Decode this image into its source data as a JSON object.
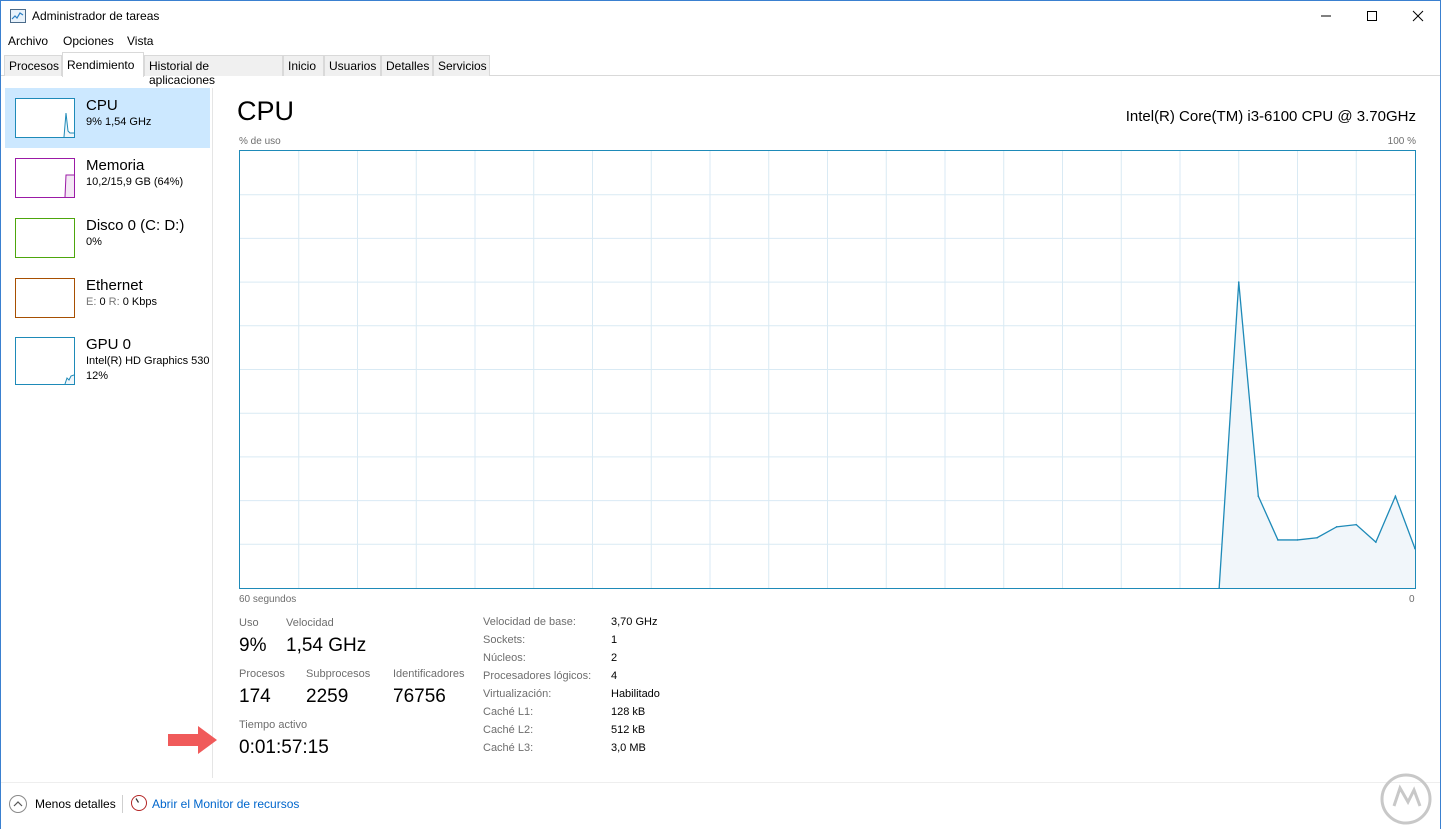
{
  "window": {
    "title": "Administrador de tareas",
    "minimize_glyph": "—",
    "maximize_glyph": "☐",
    "close_glyph": "✕",
    "border_color": "#3a80d0"
  },
  "menu": [
    "Archivo",
    "Opciones",
    "Vista"
  ],
  "tabs": [
    {
      "label": "Procesos",
      "active": false
    },
    {
      "label": "Rendimiento",
      "active": true
    },
    {
      "label": "Historial de aplicaciones",
      "active": false
    },
    {
      "label": "Inicio",
      "active": false
    },
    {
      "label": "Usuarios",
      "active": false
    },
    {
      "label": "Detalles",
      "active": false
    },
    {
      "label": "Servicios",
      "active": false
    }
  ],
  "sidebar": {
    "items": [
      {
        "title": "CPU",
        "sub": "9%  1,54 GHz",
        "color": "#1e8ab8",
        "selected": true
      },
      {
        "title": "Memoria",
        "sub": "10,2/15,9 GB (64%)",
        "color": "#9b1aa6",
        "selected": false
      },
      {
        "title": "Disco 0 (C: D:)",
        "sub": "0%",
        "color": "#4da60c",
        "selected": false
      },
      {
        "title": "Ethernet",
        "sub_prefix_e": "E:",
        "sub_e": "0",
        "sub_prefix_r": "R:",
        "sub_r": "0 Kbps",
        "color": "#a74f01",
        "selected": false
      },
      {
        "title": "GPU 0",
        "sub": "Intel(R) HD Graphics 530",
        "sub2": "12%",
        "color": "#1e8ab8",
        "selected": false
      }
    ]
  },
  "main": {
    "title": "CPU",
    "model": "Intel(R) Core(TM) i3-6100 CPU @ 3.70GHz",
    "y_axis_label": "% de uso",
    "y_axis_max": "100 %",
    "x_axis_left": "60 segundos",
    "x_axis_right": "0"
  },
  "chart_data": {
    "type": "area",
    "x": [
      60,
      59,
      58,
      57,
      56,
      55,
      54,
      53,
      52,
      51,
      50,
      49,
      48,
      47,
      46,
      45,
      44,
      43,
      42,
      41,
      40,
      39,
      38,
      37,
      36,
      35,
      34,
      33,
      32,
      31,
      30,
      29,
      28,
      27,
      26,
      25,
      24,
      23,
      22,
      21,
      20,
      19,
      18,
      17,
      16,
      15,
      14,
      13,
      12,
      11,
      10,
      9,
      8,
      7,
      6,
      5,
      4,
      3,
      2,
      1,
      0
    ],
    "series": [
      {
        "values": [
          null,
          null,
          null,
          null,
          null,
          null,
          null,
          null,
          null,
          null,
          null,
          null,
          null,
          null,
          null,
          null,
          null,
          null,
          null,
          null,
          null,
          null,
          null,
          null,
          null,
          null,
          null,
          null,
          null,
          null,
          null,
          null,
          null,
          null,
          null,
          null,
          null,
          null,
          null,
          null,
          null,
          null,
          null,
          null,
          null,
          null,
          null,
          null,
          null,
          null,
          0,
          70,
          21,
          11,
          11,
          11.5,
          14,
          14.5,
          10.5,
          21,
          9
        ]
      }
    ],
    "ylim": [
      0,
      100
    ],
    "xlim": [
      60,
      0
    ],
    "grid": true,
    "line_color": "#1e8ab8",
    "fill_color": "#f1f6fa",
    "grid_color": "#d9eaf4"
  },
  "stats": {
    "uso_label": "Uso",
    "uso_value": "9%",
    "velocidad_label": "Velocidad",
    "velocidad_value": "1,54 GHz",
    "procesos_label": "Procesos",
    "procesos_value": "174",
    "subprocesos_label": "Subprocesos",
    "subprocesos_value": "2259",
    "identificadores_label": "Identificadores",
    "identificadores_value": "76756",
    "tiempo_label": "Tiempo activo",
    "tiempo_value": "0:01:57:15"
  },
  "specs": [
    {
      "label": "Velocidad de base:",
      "value": "3,70 GHz"
    },
    {
      "label": "Sockets:",
      "value": "1"
    },
    {
      "label": "Núcleos:",
      "value": "2"
    },
    {
      "label": "Procesadores lógicos:",
      "value": "4"
    },
    {
      "label": "Virtualización:",
      "value": "Habilitado"
    },
    {
      "label": "Caché L1:",
      "value": "128 kB"
    },
    {
      "label": "Caché L2:",
      "value": "512 kB"
    },
    {
      "label": "Caché L3:",
      "value": "3,0 MB"
    }
  ],
  "footer": {
    "less_details": "Menos detalles",
    "open_monitor": "Abrir el Monitor de recursos"
  },
  "annotation_arrow_color": "#f05a5a"
}
